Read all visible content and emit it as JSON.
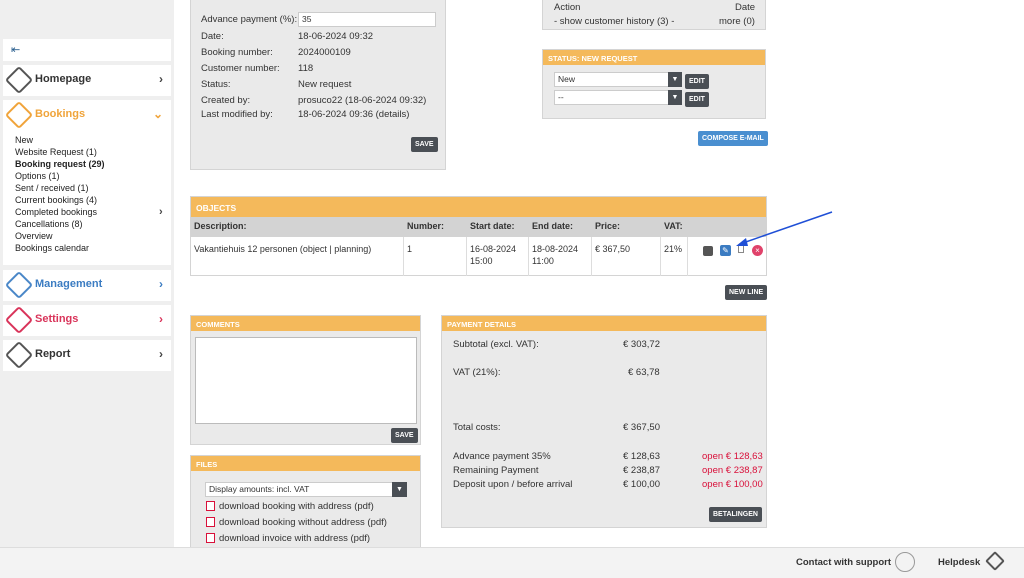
{
  "sidebar": {
    "menu_toggle": "⇤",
    "items": [
      {
        "label": "Homepage",
        "icon": "home-icon"
      },
      {
        "label": "Bookings",
        "icon": "bookings-icon"
      },
      {
        "label": "Management",
        "icon": "management-icon"
      },
      {
        "label": "Settings",
        "icon": "settings-icon"
      },
      {
        "label": "Report",
        "icon": "report-icon"
      }
    ],
    "bookings_sub": [
      "New",
      "Website Request (1)",
      "Booking request (29)",
      "Options (1)",
      "Sent / received (1)",
      "Current bookings (4)",
      "Completed bookings",
      "Cancellations (8)",
      "Overview",
      "Bookings calendar"
    ]
  },
  "details": {
    "advance_label": "Advance payment (%):",
    "advance_value": "35",
    "rows": [
      {
        "label": "Date:",
        "value": "18-06-2024 09:32"
      },
      {
        "label": "Booking number:",
        "value": "2024000109"
      },
      {
        "label": "Customer number:",
        "value": "118"
      },
      {
        "label": "Status:",
        "value": "New request"
      },
      {
        "label": "Created by:",
        "value": "prosuco22 (18-06-2024 09:32)"
      },
      {
        "label": "Last modified by:",
        "value": "18-06-2024 09:36 (details)"
      }
    ],
    "save": "SAVE"
  },
  "action_box": {
    "action_label": "Action",
    "date_label": "Date",
    "history_link": "- show customer history (3) -",
    "more_link": "more (0)"
  },
  "status": {
    "title": "STATUS: NEW REQUEST",
    "select1": "New",
    "select2": "--",
    "edit": "EDIT"
  },
  "compose": "COMPOSE E-MAIL",
  "objects": {
    "title": "OBJECTS",
    "headers": [
      "Description:",
      "Number:",
      "Start date:",
      "End date:",
      "Price:",
      "VAT:"
    ],
    "row": {
      "description": "Vakantiehuis 12 personen (object | planning)",
      "number": "1",
      "start_date": "16-08-2024",
      "start_time": "15:00",
      "end_date": "18-08-2024",
      "end_time": "11:00",
      "price": "€ 367,50",
      "vat": "21%"
    },
    "new_line": "NEW LINE"
  },
  "comments": {
    "title": "COMMENTS",
    "save": "SAVE"
  },
  "files": {
    "title": "FILES",
    "select": "Display amounts: incl. VAT",
    "links": [
      "download booking with address (pdf)",
      "download booking without address (pdf)",
      "download invoice with address (pdf)"
    ]
  },
  "payment": {
    "title": "PAYMENT DETAILS",
    "subtotal_label": "Subtotal (excl. VAT):",
    "subtotal": "€ 303,72",
    "vat_label": "VAT (21%):",
    "vat": "€ 63,78",
    "total_label": "Total costs:",
    "total": "€ 367,50",
    "lines": [
      {
        "label": "Advance payment 35%",
        "amount": "€ 128,63",
        "open": "open € 128,63"
      },
      {
        "label": "Remaining Payment",
        "amount": "€ 238,87",
        "open": "open € 238,87"
      },
      {
        "label": "Deposit upon / before arrival",
        "amount": "€ 100,00",
        "open": "open € 100,00"
      }
    ],
    "pay_button": "BETALINGEN"
  },
  "footer": {
    "support": "Contact with support",
    "helpdesk": "Helpdesk"
  },
  "colors": {
    "accent": "#f4b95b",
    "blue": "#3b7cc2",
    "red": "#d9345a",
    "open_red": "#d9103a"
  }
}
